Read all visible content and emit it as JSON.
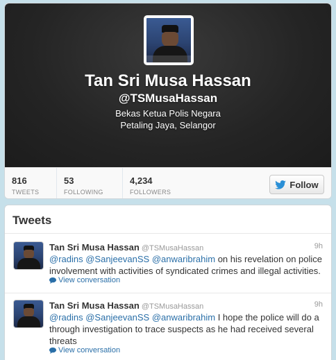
{
  "profile": {
    "name": "Tan Sri Musa Hassan",
    "handle": "@TSMusaHassan",
    "bio": "Bekas Ketua Polis Negara",
    "location": "Petaling Jaya, Selangor",
    "header_color": "#262626"
  },
  "stats": [
    {
      "value": "816",
      "label": "TWEETS"
    },
    {
      "value": "53",
      "label": "FOLLOWING"
    },
    {
      "value": "4,234",
      "label": "FOLLOWERS"
    }
  ],
  "follow_button": {
    "label": "Follow",
    "icon": "twitter-bird-icon",
    "icon_color": "#2a8fd6"
  },
  "tweets_section": {
    "title": "Tweets"
  },
  "tweets": [
    {
      "author": "Tan Sri Musa Hassan",
      "screen_name": "@TSMusaHassan",
      "time": "9h",
      "mentions": [
        "@radins",
        "@SanjeevanSS",
        "@anwaribrahim"
      ],
      "text": " on his revelation on police involvement with activities of syndicated crimes and illegal activities.",
      "conversation_link": "View conversation"
    },
    {
      "author": "Tan Sri Musa Hassan",
      "screen_name": "@TSMusaHassan",
      "time": "9h",
      "mentions": [
        "@radins",
        "@SanjeevanSS",
        "@anwaribrahim"
      ],
      "text": " I hope the police will do a through investigation to trace suspects as he had received several threats",
      "conversation_link": "View conversation"
    }
  ],
  "colors": {
    "link": "#2a6fa8",
    "page_bg": "#c6e0ea"
  }
}
